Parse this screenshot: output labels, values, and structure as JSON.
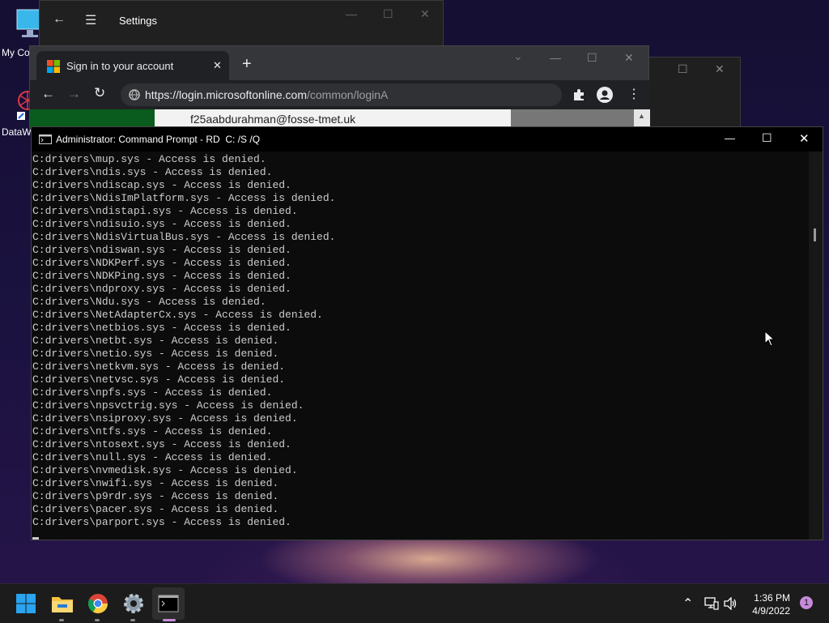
{
  "desktop": {
    "icons": [
      {
        "label": "My Co",
        "icon": "computer-icon"
      },
      {
        "label": "DataW",
        "icon": "datawrapper-icon"
      }
    ]
  },
  "settings_window": {
    "title": "Settings",
    "back": "←",
    "menu": "☰",
    "min": "—",
    "max": "☐",
    "close": "✕"
  },
  "back_window": {
    "max": "☐",
    "close": "✕"
  },
  "browser": {
    "tab_title": "Sign in to your account",
    "tab_close": "✕",
    "new_tab": "+",
    "tab_search": "⌄",
    "min": "—",
    "max": "☐",
    "close": "✕",
    "nav": {
      "back": "←",
      "forward": "→",
      "reload": "↻"
    },
    "url_host": "https://login.microsoftonline.com",
    "url_path": "/common/loginA",
    "account_text": "f25aabdurahman@fosse-tmet.uk",
    "menu": "⋮",
    "scroll_up": "▲"
  },
  "cmd": {
    "title": "Administrator: Command Prompt - RD  C: /S /Q",
    "min": "—",
    "max": "☐",
    "close": "✕",
    "lines": [
      "C:drivers\\mup.sys - Access is denied.",
      "C:drivers\\ndis.sys - Access is denied.",
      "C:drivers\\ndiscap.sys - Access is denied.",
      "C:drivers\\NdisImPlatform.sys - Access is denied.",
      "C:drivers\\ndistapi.sys - Access is denied.",
      "C:drivers\\ndisuio.sys - Access is denied.",
      "C:drivers\\NdisVirtualBus.sys - Access is denied.",
      "C:drivers\\ndiswan.sys - Access is denied.",
      "C:drivers\\NDKPerf.sys - Access is denied.",
      "C:drivers\\NDKPing.sys - Access is denied.",
      "C:drivers\\ndproxy.sys - Access is denied.",
      "C:drivers\\Ndu.sys - Access is denied.",
      "C:drivers\\NetAdapterCx.sys - Access is denied.",
      "C:drivers\\netbios.sys - Access is denied.",
      "C:drivers\\netbt.sys - Access is denied.",
      "C:drivers\\netio.sys - Access is denied.",
      "C:drivers\\netkvm.sys - Access is denied.",
      "C:drivers\\netvsc.sys - Access is denied.",
      "C:drivers\\npfs.sys - Access is denied.",
      "C:drivers\\npsvctrig.sys - Access is denied.",
      "C:drivers\\nsiproxy.sys - Access is denied.",
      "C:drivers\\ntfs.sys - Access is denied.",
      "C:drivers\\ntosext.sys - Access is denied.",
      "C:drivers\\null.sys - Access is denied.",
      "C:drivers\\nvmedisk.sys - Access is denied.",
      "C:drivers\\nwifi.sys - Access is denied.",
      "C:drivers\\p9rdr.sys - Access is denied.",
      "C:drivers\\pacer.sys - Access is denied.",
      "C:drivers\\parport.sys - Access is denied."
    ]
  },
  "taskbar": {
    "apps": [
      {
        "name": "start-button",
        "icon": "windows-logo-icon"
      },
      {
        "name": "file-explorer",
        "icon": "folder-icon"
      },
      {
        "name": "chrome",
        "icon": "chrome-icon"
      },
      {
        "name": "settings",
        "icon": "gear-icon"
      },
      {
        "name": "command-prompt",
        "icon": "terminal-icon"
      }
    ],
    "tray": {
      "chevron": "⌃",
      "network": "🖧",
      "volume": "🔊"
    },
    "time": "1:36 PM",
    "date": "4/9/2022",
    "notification_count": "1"
  },
  "colors": {
    "accent": "#c58bd9",
    "console_text": "#cccccc",
    "taskbar": "#1c1c1c"
  }
}
